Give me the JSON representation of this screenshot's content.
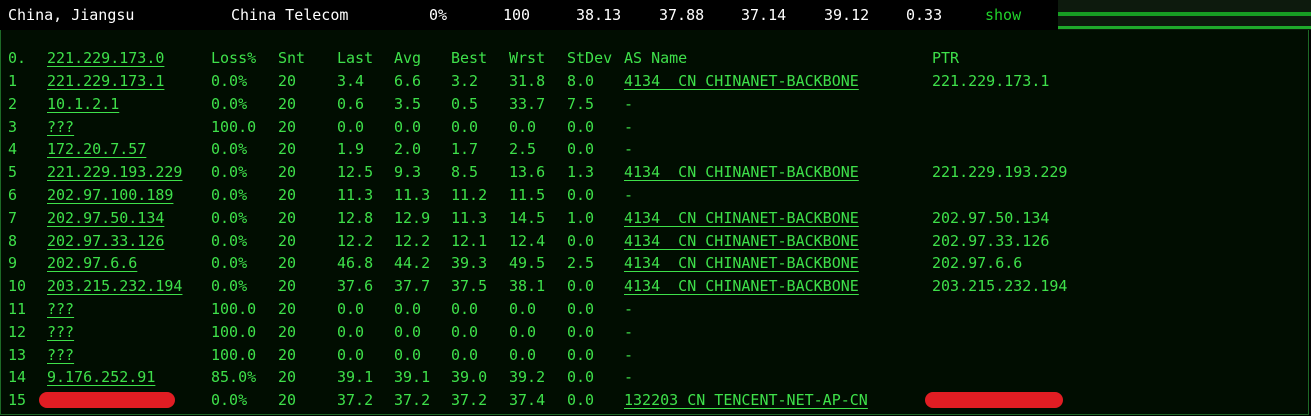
{
  "summary": {
    "location": "China, Jiangsu",
    "isp": "China Telecom",
    "loss": "0%",
    "sent": "100",
    "last": "38.13",
    "avg": "37.88",
    "best": "37.14",
    "worst": "39.12",
    "stdev": "0.33",
    "show_label": "show"
  },
  "colors": {
    "text": "#3ee04a",
    "panel_bg": "#010d01",
    "redaction": "#e11d23"
  },
  "headers": {
    "hop": "0.",
    "host": "221.229.173.0",
    "loss": "Loss%",
    "snt": "Snt",
    "last": "Last",
    "avg": "Avg",
    "best": "Best",
    "wrst": "Wrst",
    "stdev": "StDev",
    "as_name": "AS Name",
    "ptr": "PTR"
  },
  "hops": [
    {
      "hop": "1",
      "host": "221.229.173.1",
      "loss": "0.0%",
      "snt": "20",
      "last": "3.4",
      "avg": "6.6",
      "best": "3.2",
      "wrst": "31.8",
      "stdev": "8.0",
      "as": "4134  CN CHINANET-BACKBONE",
      "ptr": "221.229.173.1"
    },
    {
      "hop": "2",
      "host": "10.1.2.1",
      "loss": "0.0%",
      "snt": "20",
      "last": "0.6",
      "avg": "3.5",
      "best": "0.5",
      "wrst": "33.7",
      "stdev": "7.5",
      "as": "-",
      "ptr": ""
    },
    {
      "hop": "3",
      "host": "???",
      "loss": "100.0",
      "snt": "20",
      "last": "0.0",
      "avg": "0.0",
      "best": "0.0",
      "wrst": "0.0",
      "stdev": "0.0",
      "as": "-",
      "ptr": ""
    },
    {
      "hop": "4",
      "host": "172.20.7.57",
      "loss": "0.0%",
      "snt": "20",
      "last": "1.9",
      "avg": "2.0",
      "best": "1.7",
      "wrst": "2.5",
      "stdev": "0.0",
      "as": "-",
      "ptr": ""
    },
    {
      "hop": "5",
      "host": "221.229.193.229",
      "loss": "0.0%",
      "snt": "20",
      "last": "12.5",
      "avg": "9.3",
      "best": "8.5",
      "wrst": "13.6",
      "stdev": "1.3",
      "as": "4134  CN CHINANET-BACKBONE",
      "ptr": "221.229.193.229"
    },
    {
      "hop": "6",
      "host": "202.97.100.189",
      "loss": "0.0%",
      "snt": "20",
      "last": "11.3",
      "avg": "11.3",
      "best": "11.2",
      "wrst": "11.5",
      "stdev": "0.0",
      "as": "-",
      "ptr": ""
    },
    {
      "hop": "7",
      "host": "202.97.50.134",
      "loss": "0.0%",
      "snt": "20",
      "last": "12.8",
      "avg": "12.9",
      "best": "11.3",
      "wrst": "14.5",
      "stdev": "1.0",
      "as": "4134  CN CHINANET-BACKBONE",
      "ptr": "202.97.50.134"
    },
    {
      "hop": "8",
      "host": "202.97.33.126",
      "loss": "0.0%",
      "snt": "20",
      "last": "12.2",
      "avg": "12.2",
      "best": "12.1",
      "wrst": "12.4",
      "stdev": "0.0",
      "as": "4134  CN CHINANET-BACKBONE",
      "ptr": "202.97.33.126"
    },
    {
      "hop": "9",
      "host": "202.97.6.6",
      "loss": "0.0%",
      "snt": "20",
      "last": "46.8",
      "avg": "44.2",
      "best": "39.3",
      "wrst": "49.5",
      "stdev": "2.5",
      "as": "4134  CN CHINANET-BACKBONE",
      "ptr": "202.97.6.6"
    },
    {
      "hop": "10",
      "host": "203.215.232.194",
      "loss": "0.0%",
      "snt": "20",
      "last": "37.6",
      "avg": "37.7",
      "best": "37.5",
      "wrst": "38.1",
      "stdev": "0.0",
      "as": "4134  CN CHINANET-BACKBONE",
      "ptr": "203.215.232.194"
    },
    {
      "hop": "11",
      "host": "???",
      "loss": "100.0",
      "snt": "20",
      "last": "0.0",
      "avg": "0.0",
      "best": "0.0",
      "wrst": "0.0",
      "stdev": "0.0",
      "as": "-",
      "ptr": ""
    },
    {
      "hop": "12",
      "host": "???",
      "loss": "100.0",
      "snt": "20",
      "last": "0.0",
      "avg": "0.0",
      "best": "0.0",
      "wrst": "0.0",
      "stdev": "0.0",
      "as": "-",
      "ptr": ""
    },
    {
      "hop": "13",
      "host": "???",
      "loss": "100.0",
      "snt": "20",
      "last": "0.0",
      "avg": "0.0",
      "best": "0.0",
      "wrst": "0.0",
      "stdev": "0.0",
      "as": "-",
      "ptr": ""
    },
    {
      "hop": "14",
      "host": "9.176.252.91",
      "loss": "85.0%",
      "snt": "20",
      "last": "39.1",
      "avg": "39.1",
      "best": "39.0",
      "wrst": "39.2",
      "stdev": "0.0",
      "as": "-",
      "ptr": ""
    },
    {
      "hop": "15",
      "host": "",
      "loss": "0.0%",
      "snt": "20",
      "last": "37.2",
      "avg": "37.2",
      "best": "37.2",
      "wrst": "37.4",
      "stdev": "0.0",
      "as": "132203 CN TENCENT-NET-AP-CN",
      "ptr": ""
    }
  ]
}
